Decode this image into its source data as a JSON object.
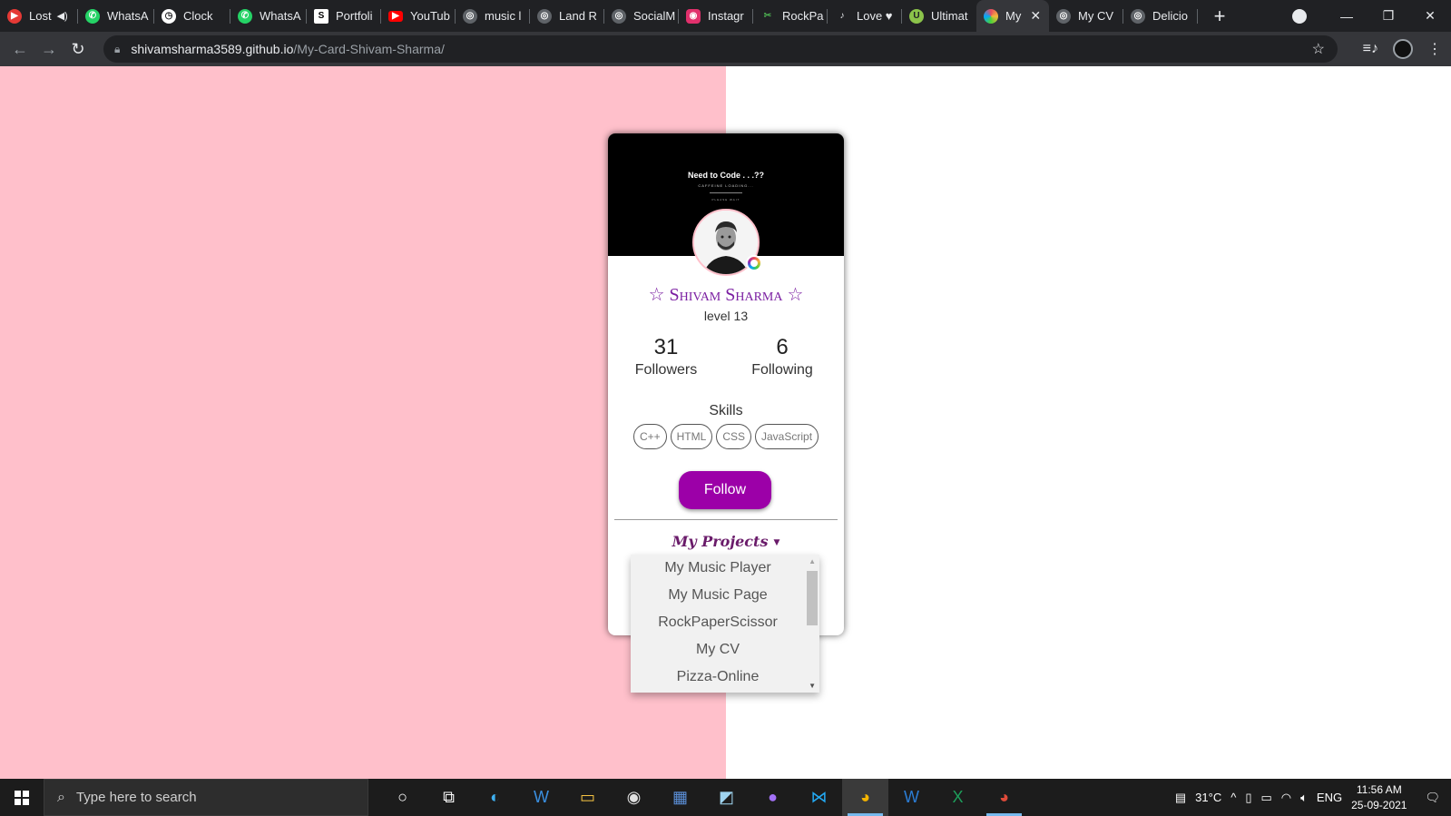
{
  "browser": {
    "tabs": [
      {
        "label": "Lost",
        "icon": "youtube-music-icon",
        "color": "#e53935"
      },
      {
        "label": "WhatsA",
        "icon": "whatsapp-icon",
        "color": "#25d366"
      },
      {
        "label": "Clock",
        "icon": "clock-icon",
        "color": "#ffffff"
      },
      {
        "label": "WhatsA",
        "icon": "whatsapp-icon",
        "color": "#25d366"
      },
      {
        "label": "Portfoli",
        "icon": "portfolio-icon",
        "color": "#ffffff"
      },
      {
        "label": "YouTub",
        "icon": "youtube-icon",
        "color": "#ff0000"
      },
      {
        "label": "music l",
        "icon": "globe-icon",
        "color": "#9aa0a6"
      },
      {
        "label": "Land R",
        "icon": "globe-icon",
        "color": "#9aa0a6"
      },
      {
        "label": "SocialM",
        "icon": "globe-icon",
        "color": "#9aa0a6"
      },
      {
        "label": "Instagr",
        "icon": "instagram-icon",
        "color": "#e1306c"
      },
      {
        "label": "RockPa",
        "icon": "rockpaper-icon",
        "color": "#4caf50"
      },
      {
        "label": "Love ♥",
        "icon": "love-icon",
        "color": "#e8eaed"
      },
      {
        "label": "Ultimat",
        "icon": "ultimate-icon",
        "color": "#8bc34a"
      },
      {
        "label": "My",
        "icon": "chrome-icon",
        "color": "#ff6d00",
        "active": true
      },
      {
        "label": "My CV",
        "icon": "globe-icon",
        "color": "#9aa0a6"
      },
      {
        "label": "Delicio",
        "icon": "globe-icon",
        "color": "#9aa0a6"
      }
    ],
    "url_host": "shivamsharma3589.github.io",
    "url_path": "/My-Card-Shivam-Sharma/"
  },
  "page": {
    "pink_color": "#ffc0cb",
    "banner": {
      "title": "Need to Code . . .??",
      "subtitle": "CAFFEINE LOADING...",
      "wait": "PLEASE WAIT"
    },
    "name": "☆ Shivam Sharma ☆",
    "level": "level 13",
    "followers_count": "31",
    "followers_label": "Followers",
    "following_count": "6",
    "following_label": "Following",
    "skills_title": "Skills",
    "skills": [
      "C++",
      "HTML",
      "CSS",
      "JavaScript"
    ],
    "follow_label": "Follow",
    "accent_color": "#9c00a8",
    "projects_title": "My Projects",
    "projects": [
      "My Music Player",
      "My Music Page",
      "RockPaperScissor",
      "My CV",
      "Pizza-Online"
    ]
  },
  "taskbar": {
    "search_placeholder": "Type here to search",
    "temperature": "31°C",
    "language": "ENG",
    "time": "11:56 AM",
    "date": "25-09-2021"
  }
}
